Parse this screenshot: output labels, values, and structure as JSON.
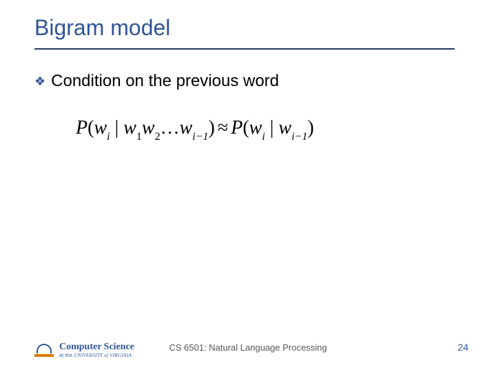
{
  "title": "Bigram model",
  "bullet": "Condition on the previous word",
  "equation": {
    "lhs_P": "P",
    "lhs_open": "(",
    "w": "w",
    "i": "i",
    "bar": " | ",
    "one": "1",
    "two": "2",
    "ellipsis": "…",
    "im1": "i−1",
    "close": ")",
    "approx": "≈"
  },
  "footer": {
    "logo_line1": "Computer Science",
    "logo_line2_prefix": "at the ",
    "logo_line2_uva": "UNIVERSITY of VIRGINIA",
    "center": "CS 6501: Natural Language Processing",
    "page": "24"
  }
}
